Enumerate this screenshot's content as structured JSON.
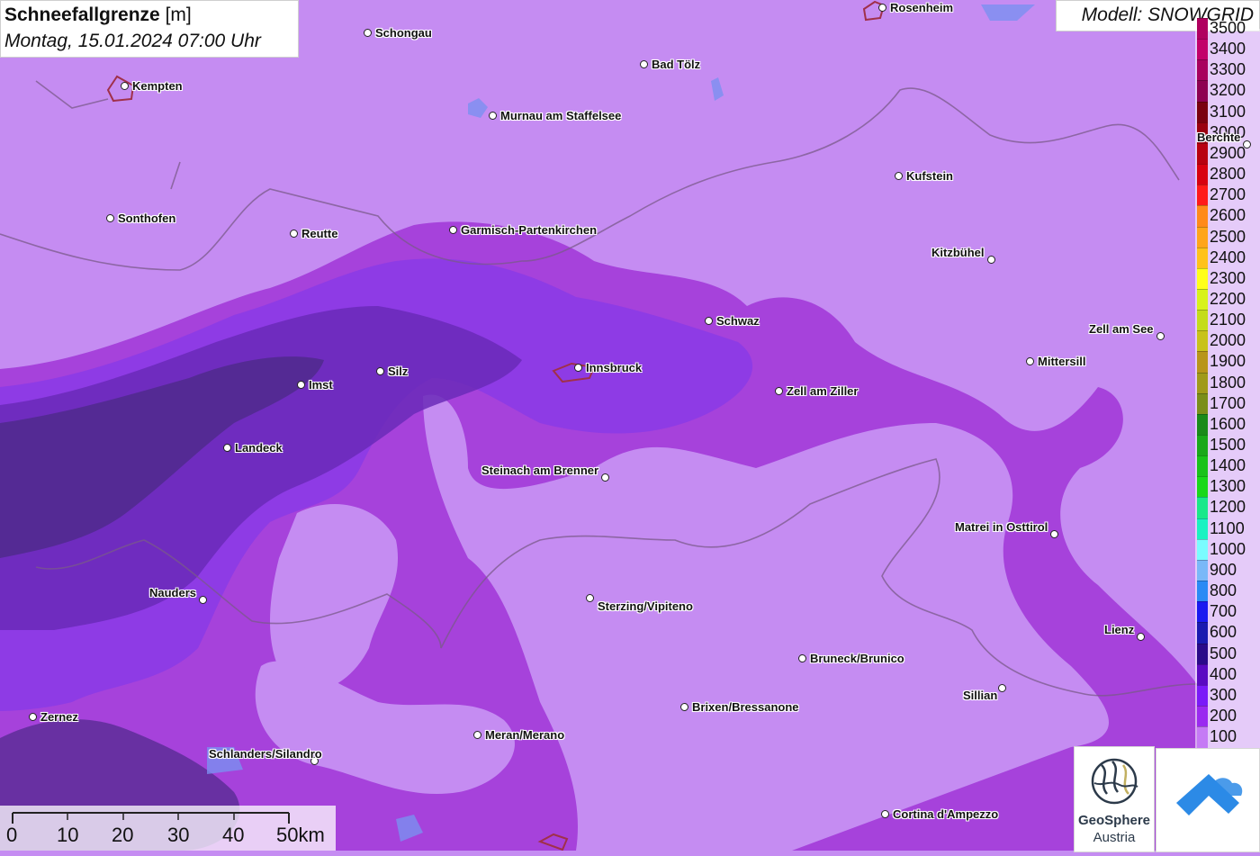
{
  "title": {
    "variable": "Schneefallgrenze",
    "unit": "[m]",
    "datetime": "Montag, 15.01.2024 07:00 Uhr"
  },
  "model": {
    "label": "Modell: SNOWGRID"
  },
  "legend": {
    "items": [
      {
        "value": "3500",
        "color": "#b0005f"
      },
      {
        "value": "3400",
        "color": "#c2006a"
      },
      {
        "value": "3300",
        "color": "#a8005e"
      },
      {
        "value": "3200",
        "color": "#8e0052"
      },
      {
        "value": "3100",
        "color": "#7a0010"
      },
      {
        "value": "3000",
        "color": "#9a0010"
      },
      {
        "value": "2900",
        "color": "#b80010"
      },
      {
        "value": "2800",
        "color": "#d80010"
      },
      {
        "value": "2700",
        "color": "#ff1a1a"
      },
      {
        "value": "2600",
        "color": "#ff8a1a"
      },
      {
        "value": "2500",
        "color": "#ffa51a"
      },
      {
        "value": "2400",
        "color": "#ffc21a"
      },
      {
        "value": "2300",
        "color": "#ffff1a"
      },
      {
        "value": "2200",
        "color": "#d8f21a"
      },
      {
        "value": "2100",
        "color": "#c4dc1a"
      },
      {
        "value": "2000",
        "color": "#c8c21a"
      },
      {
        "value": "1900",
        "color": "#b8951a"
      },
      {
        "value": "1800",
        "color": "#a09a1a"
      },
      {
        "value": "1700",
        "color": "#7a8e1a"
      },
      {
        "value": "1600",
        "color": "#1a8a1a"
      },
      {
        "value": "1500",
        "color": "#1aa81a"
      },
      {
        "value": "1400",
        "color": "#1ac21a"
      },
      {
        "value": "1300",
        "color": "#1ad81a"
      },
      {
        "value": "1200",
        "color": "#1ae88a"
      },
      {
        "value": "1100",
        "color": "#1af2c2"
      },
      {
        "value": "1000",
        "color": "#7afcff"
      },
      {
        "value": "900",
        "color": "#7ab8f8"
      },
      {
        "value": "800",
        "color": "#2a8af5"
      },
      {
        "value": "700",
        "color": "#1a1af0"
      },
      {
        "value": "600",
        "color": "#1a1ab0"
      },
      {
        "value": "500",
        "color": "#2a0a8a"
      },
      {
        "value": "400",
        "color": "#5a0ac2"
      },
      {
        "value": "300",
        "color": "#7a1af8"
      },
      {
        "value": "200",
        "color": "#9a2af0"
      },
      {
        "value": "100",
        "color": "#c57af5"
      }
    ]
  },
  "cities": [
    {
      "name": "Rosenheim"
    },
    {
      "name": "Schongau"
    },
    {
      "name": "Kempten"
    },
    {
      "name": "Bad Tölz"
    },
    {
      "name": "Murnau am Staffelsee"
    },
    {
      "name": "Berchte"
    },
    {
      "name": "Kufstein"
    },
    {
      "name": "Sonthofen"
    },
    {
      "name": "Reutte"
    },
    {
      "name": "Garmisch-Partenkirchen"
    },
    {
      "name": "Kitzbühel"
    },
    {
      "name": "Schwaz"
    },
    {
      "name": "Zell am See"
    },
    {
      "name": "Silz"
    },
    {
      "name": "Innsbruck"
    },
    {
      "name": "Mittersill"
    },
    {
      "name": "Imst"
    },
    {
      "name": "Zell am Ziller"
    },
    {
      "name": "Landeck"
    },
    {
      "name": "Steinach am Brenner"
    },
    {
      "name": "Matrei in Osttirol"
    },
    {
      "name": "Nauders"
    },
    {
      "name": "Sterzing/Vipiteno"
    },
    {
      "name": "Lienz"
    },
    {
      "name": "Bruneck/Brunico"
    },
    {
      "name": "Sillian"
    },
    {
      "name": "Brixen/Bressanone"
    },
    {
      "name": "Zernez"
    },
    {
      "name": "Meran/Merano"
    },
    {
      "name": "Schlanders/Silandro"
    },
    {
      "name": "Cortina d'Ampezzo"
    }
  ],
  "scalebar": {
    "ticks": [
      "0",
      "10",
      "20",
      "30",
      "40",
      "50km"
    ]
  },
  "logos": {
    "geosphere_line1": "GeoSphere",
    "geosphere_line2": "Austria"
  }
}
